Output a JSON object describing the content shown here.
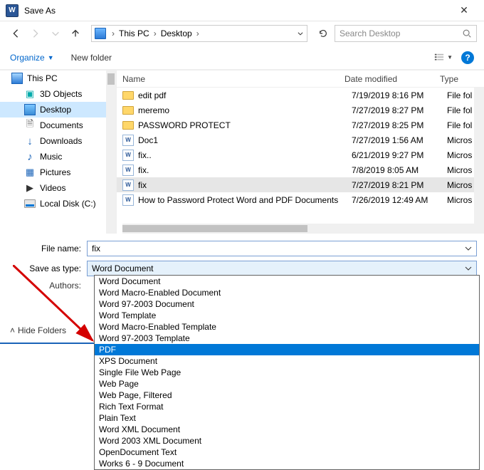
{
  "window": {
    "title": "Save As",
    "close": "✕"
  },
  "nav": {
    "pc": "This PC",
    "desktop": "Desktop",
    "search_placeholder": "Search Desktop"
  },
  "toolbar": {
    "organize": "Organize",
    "new_folder": "New folder"
  },
  "tree": {
    "this_pc": "This PC",
    "items": [
      {
        "label": "3D Objects"
      },
      {
        "label": "Desktop"
      },
      {
        "label": "Documents"
      },
      {
        "label": "Downloads"
      },
      {
        "label": "Music"
      },
      {
        "label": "Pictures"
      },
      {
        "label": "Videos"
      },
      {
        "label": "Local Disk (C:)"
      }
    ]
  },
  "list": {
    "headers": {
      "name": "Name",
      "date": "Date modified",
      "type": "Type"
    },
    "rows": [
      {
        "kind": "folder",
        "name": "edit pdf",
        "date": "7/19/2019 8:16 PM",
        "type": "File fol"
      },
      {
        "kind": "folder",
        "name": "meremo",
        "date": "7/27/2019 8:27 PM",
        "type": "File fol"
      },
      {
        "kind": "folder",
        "name": "PASSWORD PROTECT",
        "date": "7/27/2019 8:25 PM",
        "type": "File fol"
      },
      {
        "kind": "word",
        "name": "Doc1",
        "date": "7/27/2019 1:56 AM",
        "type": "Micros"
      },
      {
        "kind": "word",
        "name": "fix..",
        "date": "6/21/2019 9:27 PM",
        "type": "Micros"
      },
      {
        "kind": "word",
        "name": "fix.",
        "date": "7/8/2019 8:05 AM",
        "type": "Micros"
      },
      {
        "kind": "word",
        "name": "fix",
        "date": "7/27/2019 8:21 PM",
        "type": "Micros",
        "selected": true
      },
      {
        "kind": "word",
        "name": "How to Password Protect Word and PDF Documents",
        "date": "7/26/2019 12:49 AM",
        "type": "Micros"
      }
    ]
  },
  "fields": {
    "filename_label": "File name:",
    "filename_value": "fix",
    "saveas_label": "Save as type:",
    "saveas_value": "Word Document",
    "authors_label": "Authors:"
  },
  "footer": {
    "hide": "Hide Folders"
  },
  "dropdown": {
    "options": [
      "Word Document",
      "Word Macro-Enabled Document",
      "Word 97-2003 Document",
      "Word Template",
      "Word Macro-Enabled Template",
      "Word 97-2003 Template",
      "PDF",
      "XPS Document",
      "Single File Web Page",
      "Web Page",
      "Web Page, Filtered",
      "Rich Text Format",
      "Plain Text",
      "Word XML Document",
      "Word 2003 XML Document",
      "OpenDocument Text",
      "Works 6 - 9 Document"
    ],
    "selected_index": 6
  }
}
